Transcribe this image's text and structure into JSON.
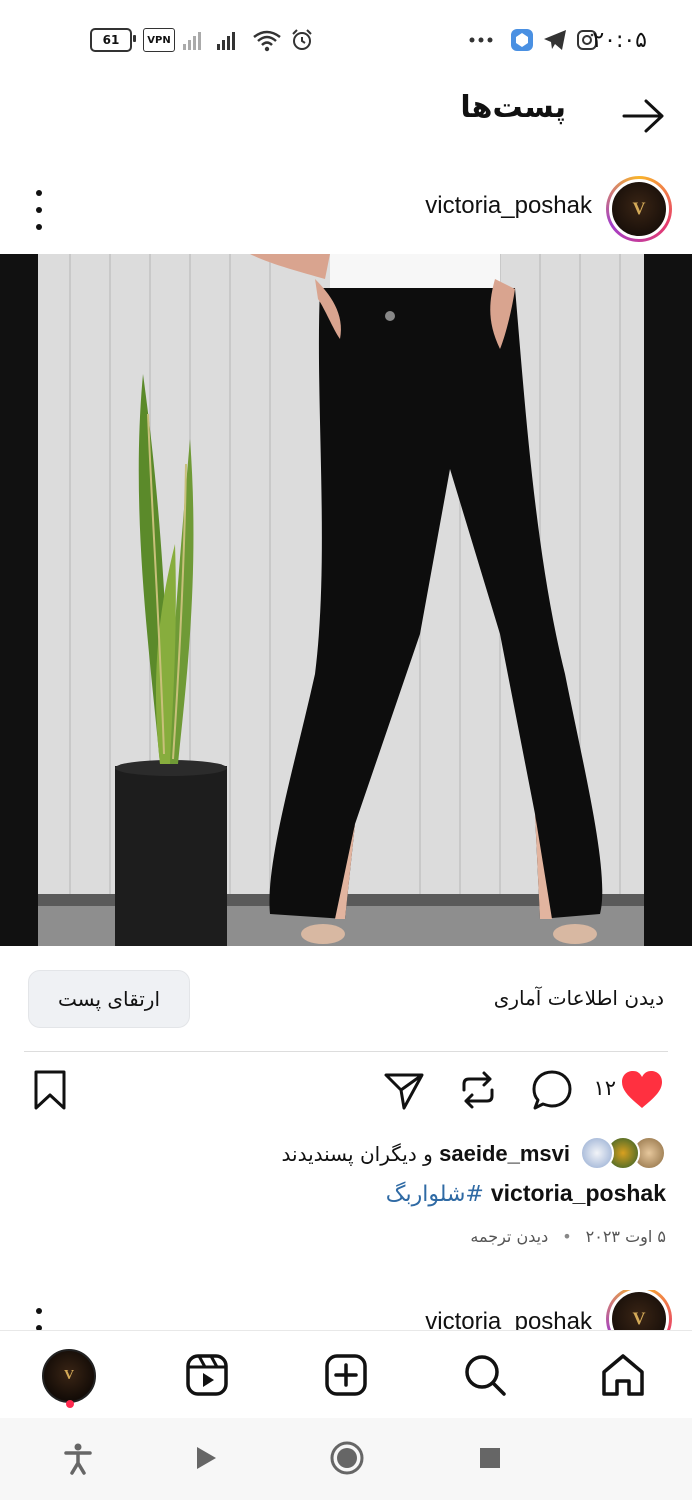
{
  "status_bar": {
    "time": "۲۰:۰۵",
    "battery": "61",
    "vpn": "VPN",
    "icons": [
      "telegram-icon",
      "instagram-icon",
      "app-icon",
      "alarm-icon",
      "wifi-icon",
      "signal-icon"
    ]
  },
  "header": {
    "title": "پست‌ها"
  },
  "post": {
    "username": "victoria_poshak",
    "avatar_monogram": "V",
    "boost_label": "ارتقای پست",
    "view_insights_label": "دیدن اطلاعات آماری",
    "likes_count": "۱۲",
    "liked_by_prefix": "و دیگران پسندیدند",
    "liked_by_user": "saeide_msvi",
    "caption_user": "victoria_poshak",
    "caption_hashtag": "#شلواربگ",
    "date": "۵ اوت ۲۰۲۳",
    "see_translation": "دیدن ترجمه"
  },
  "next_post": {
    "username": "victoria_poshak"
  },
  "colors": {
    "like_red": "#ff3040",
    "hashtag_blue": "#2f6aa4",
    "notification_dot": "#ff2a4f"
  }
}
